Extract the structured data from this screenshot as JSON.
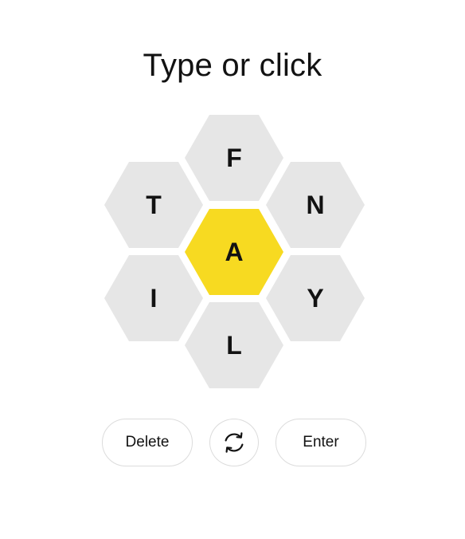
{
  "header": {
    "title": "Type or click"
  },
  "hive": {
    "center_letter": "A",
    "outer_letters": {
      "top": "F",
      "upper_left": "T",
      "upper_right": "N",
      "lower_left": "I",
      "lower_right": "Y",
      "bottom": "L"
    },
    "colors": {
      "center": "#f7da21",
      "outer": "#e6e6e6"
    }
  },
  "controls": {
    "delete_label": "Delete",
    "shuffle_icon": "shuffle-icon",
    "enter_label": "Enter"
  }
}
